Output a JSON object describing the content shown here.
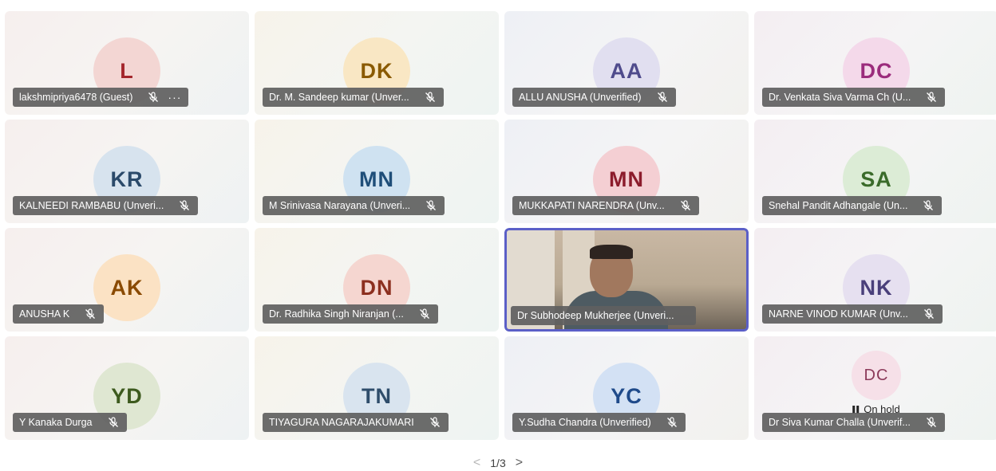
{
  "participants": [
    {
      "initials": "L",
      "name": "lakshmipriya6478 (Guest)",
      "avatar_bg": "#f3d6d3",
      "avatar_fg": "#a4262c",
      "muted": true,
      "more": "···"
    },
    {
      "initials": "DK",
      "name": "Dr. M. Sandeep kumar (Unver...",
      "avatar_bg": "#f9e7c4",
      "avatar_fg": "#8a5a00",
      "muted": true
    },
    {
      "initials": "AA",
      "name": "ALLU ANUSHA (Unverified)",
      "avatar_bg": "#e1dff0",
      "avatar_fg": "#4f4b8c",
      "muted": true
    },
    {
      "initials": "DC",
      "name": "Dr. Venkata Siva Varma Ch (U...",
      "avatar_bg": "#f4d9ea",
      "avatar_fg": "#9b2c7c",
      "muted": true
    },
    {
      "initials": "KR",
      "name": "KALNEEDI RAMBABU (Unveri...",
      "avatar_bg": "#d7e3ee",
      "avatar_fg": "#2b4a6a",
      "muted": true
    },
    {
      "initials": "MN",
      "name": "M Srinivasa Narayana (Unveri...",
      "avatar_bg": "#cfe2f1",
      "avatar_fg": "#1f4e79",
      "muted": true
    },
    {
      "initials": "MN",
      "name": "MUKKAPATI NARENDRA (Unv...",
      "avatar_bg": "#f4cfd3",
      "avatar_fg": "#8c1c2c",
      "muted": true
    },
    {
      "initials": "SA",
      "name": "Snehal Pandit Adhangale (Un...",
      "avatar_bg": "#dcecd6",
      "avatar_fg": "#3a6b2a",
      "muted": true
    },
    {
      "initials": "AK",
      "name": "ANUSHA K",
      "avatar_bg": "#fbe2c4",
      "avatar_fg": "#8a4a00",
      "muted": true
    },
    {
      "initials": "DN",
      "name": "Dr. Radhika Singh Niranjan (...",
      "avatar_bg": "#f5d6d0",
      "avatar_fg": "#8c2f1f",
      "muted": true
    },
    {
      "initials": "",
      "name": "Dr Subhodeep Mukherjee (Unveri...",
      "video": true,
      "muted": false
    },
    {
      "initials": "NK",
      "name": "NARNE VINOD KUMAR (Unv...",
      "avatar_bg": "#e6e0f0",
      "avatar_fg": "#4a3f7a",
      "muted": true
    },
    {
      "initials": "YD",
      "name": "Y Kanaka Durga",
      "avatar_bg": "#dfe7d2",
      "avatar_fg": "#3d5a1e",
      "muted": true
    },
    {
      "initials": "TN",
      "name": "TIYAGURA NAGARAJAKUMARI",
      "avatar_bg": "#d9e4ef",
      "avatar_fg": "#2f4d6b",
      "muted": true
    },
    {
      "initials": "YC",
      "name": "Y.Sudha Chandra (Unverified)",
      "avatar_bg": "#d3e1f4",
      "avatar_fg": "#1f4a8a",
      "muted": true
    },
    {
      "initials": "DC",
      "name": "Dr Siva Kumar Challa (Unverif...",
      "avatar_bg": "#f6e0e8",
      "avatar_fg": "#8c3a5a",
      "muted": true,
      "on_hold": "On hold",
      "small": true
    }
  ],
  "pager": {
    "text": "1/3",
    "prev": "<",
    "next": ">"
  }
}
